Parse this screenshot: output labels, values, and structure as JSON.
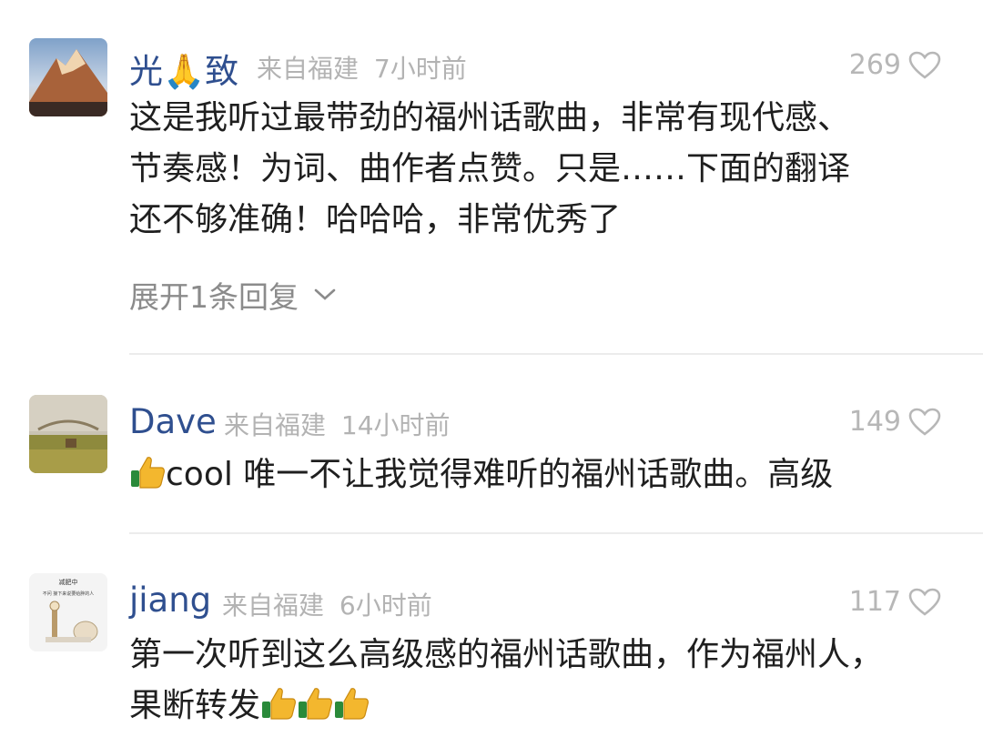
{
  "comments": [
    {
      "username": "光🙏致",
      "location": "来自福建",
      "time": "7小时前",
      "likes": "269",
      "lines": [
        "这是我听过最带劲的福州话歌曲，非常有现代感、",
        "节奏感！为词、曲作者点赞。只是……下面的翻译",
        "还不够准确！哈哈哈，非常优秀了"
      ],
      "expand_label": "展开1条回复",
      "avatar_icon": "mountain-sunset-avatar"
    },
    {
      "username": "Dave",
      "location": "来自福建",
      "time": "14小时前",
      "likes": "149",
      "line_text": "cool 唯一不让我觉得难听的福州话歌曲。高级",
      "avatar_icon": "landscape-field-avatar"
    },
    {
      "username": "jiang",
      "location": "来自福建",
      "time": "6小时前",
      "likes": "117",
      "lines": [
        "第一次听到这么高级感的福州话歌曲，作为福州人，",
        "果断转发"
      ],
      "avatar_icon": "cartoon-avatar",
      "avatar_text": [
        "减肥中",
        "不问 接下来说要给胖的人"
      ]
    }
  ],
  "icons": {
    "like": "heart-outline-icon",
    "expand": "chevron-down-icon",
    "emoji": "thumbs-up-icon"
  },
  "colors": {
    "username": "#2f4f8f",
    "meta": "#b3b3b3",
    "text": "#1f1f1f",
    "divider": "#ececec"
  }
}
